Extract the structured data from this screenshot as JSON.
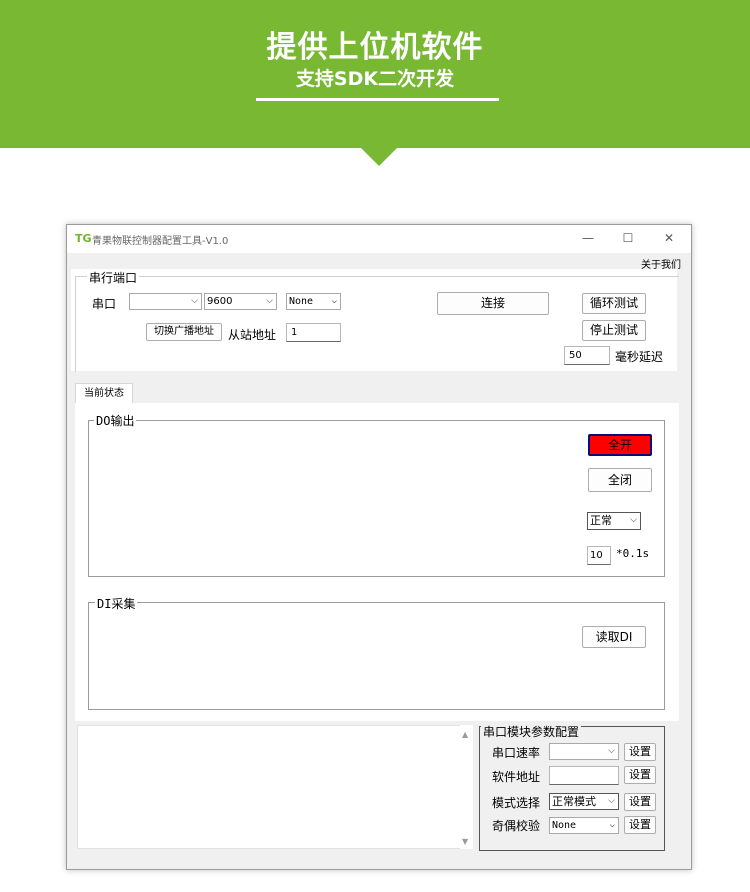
{
  "banner": {
    "title": "提供上位机软件",
    "subtitle": "支持SDK二次开发",
    "color": "#78b833"
  },
  "window": {
    "logo": "TG",
    "title": "青果物联控制器配置工具-V1.0",
    "controls": {
      "minimize": "—",
      "maximize": "☐",
      "close": "✕"
    },
    "menu_about": "关于我们"
  },
  "serial": {
    "group_label": "串行端口",
    "port_label": "串口",
    "port_value": "",
    "baud_value": "9600",
    "parity_value": "None",
    "connect_label": "连接",
    "loop_test_label": "循环测试",
    "stop_test_label": "停止测试",
    "switch_broadcast_label": "切换广播地址",
    "slave_addr_label": "从站地址",
    "slave_addr_value": "1",
    "delay_value": "50",
    "delay_label": "毫秒延迟"
  },
  "tabs": [
    {
      "label": "当前状态"
    }
  ],
  "do_output": {
    "group_label": "DO输出",
    "all_on_label": "全开",
    "all_off_label": "全闭",
    "mode_value": "正常",
    "interval_value": "10",
    "interval_unit": "*0.1s",
    "all_on_color": "#ff0000"
  },
  "di": {
    "group_label": "DI采集",
    "read_label": "读取DI"
  },
  "module_config": {
    "group_label": "串口模块参数配置",
    "rows": [
      {
        "label": "串口速率",
        "value": "",
        "set": "设置"
      },
      {
        "label": "软件地址",
        "value": "",
        "set": "设置"
      },
      {
        "label": "模式选择",
        "value": "正常模式",
        "set": "设置"
      },
      {
        "label": "奇偶校验",
        "value": "None",
        "set": "设置"
      }
    ]
  }
}
